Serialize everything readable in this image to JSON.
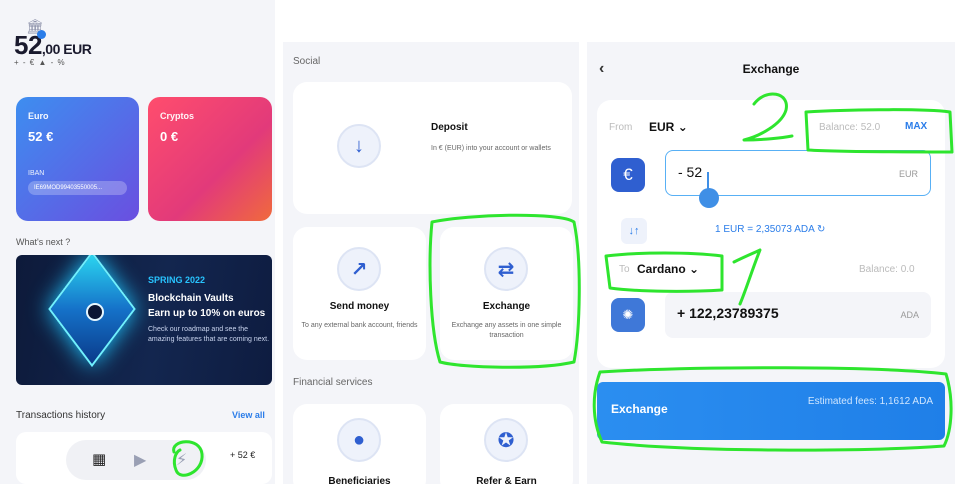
{
  "colors": {
    "accent": "#2b7de9",
    "annotation": "#2ee52e",
    "euro_card": "#3d8ef0",
    "crypto_card": "#ff4d6d"
  },
  "home": {
    "balance_main": "52",
    "balance_dec": ",00 EUR",
    "balance_sub": "+ - €   ▲ - %",
    "cards": [
      {
        "title": "Euro",
        "amount": "52 €",
        "iban_label": "IBAN",
        "iban_value": "IE69MOD99403550005..."
      },
      {
        "title": "Cryptos",
        "amount": "0 €"
      }
    ],
    "whats_next": "What's next ?",
    "promo": {
      "tag": "SPRING 2022",
      "line1": "Blockchain Vaults",
      "line2": "Earn up to 10% on euros",
      "desc": "Check our roadmap and see the amazing features that are coming next."
    },
    "transactions_title": "Transactions history",
    "view_all": "View all",
    "tx_amount": "+ 52 €",
    "icons": {
      "bank": "bank-icon",
      "grid": "grid-icon",
      "play": "play-icon",
      "bolt": "lightning-icon"
    }
  },
  "services": {
    "social_label": "Social",
    "deposit": {
      "title": "Deposit",
      "desc": "In € (EUR) into your account or wallets"
    },
    "send": {
      "title": "Send money",
      "desc": "To any external bank account, friends"
    },
    "exchange": {
      "title": "Exchange",
      "desc": "Exchange any assets in one simple transaction"
    },
    "financial_label": "Financial services",
    "beneficiaries": {
      "title": "Beneficiaries"
    },
    "refer": {
      "title": "Refer & Earn"
    }
  },
  "exchange": {
    "title": "Exchange",
    "from_label": "From",
    "from_currency": "EUR",
    "balance_label": "Balance: 52.0",
    "max_label": "MAX",
    "from_value": "- 52",
    "from_unit": "EUR",
    "rate": "1 EUR = 2,35073  ADA",
    "to_label": "To",
    "to_currency": "Cardano",
    "to_balance": "Balance: 0.0",
    "to_value": "+ 122,23789375",
    "to_unit": "ADA",
    "button_label": "Exchange",
    "fees": "Estimated fees: 1,1612 ADA"
  },
  "annotations": {
    "mark_1": "1",
    "mark_2": "2"
  }
}
